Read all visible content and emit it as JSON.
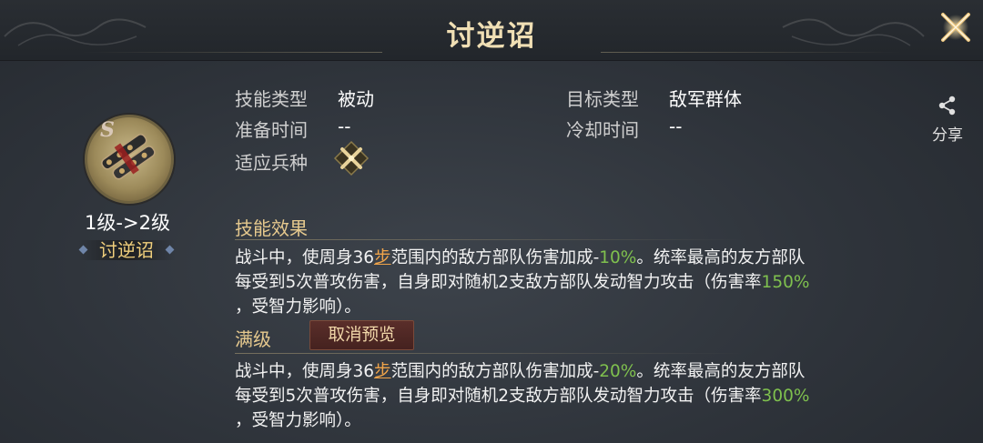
{
  "header": {
    "title": "讨逆诏"
  },
  "skill": {
    "grade": "S",
    "level_text": "1级->2级",
    "name": "讨逆诏"
  },
  "attributes": {
    "skill_type_label": "技能类型",
    "skill_type_value": "被动",
    "target_type_label": "目标类型",
    "target_type_value": "敌军群体",
    "prep_time_label": "准备时间",
    "prep_time_value": "--",
    "cooldown_label": "冷却时间",
    "cooldown_value": "--",
    "troop_label": "适应兵种",
    "troop_icon": "crossed-swords-icon"
  },
  "share": {
    "label": "分享"
  },
  "effect": {
    "title": "技能效果",
    "line1_a": "战斗中，使周身36",
    "line1_step": "步",
    "line1_b": "范围内的敌方部队伤害加成-",
    "line1_pct": "10%",
    "line1_c": "。统率最高的友方部队",
    "line2_a": "每受到5次普攻伤害，自身即对随机2支敌方部队发动智力攻击（伤害率",
    "line2_pct": "150%",
    "line3": "，受智力影响）。"
  },
  "max_level": {
    "title": "满级",
    "cancel_preview": "取消预览",
    "line1_a": "战斗中，使周身36",
    "line1_step": "步",
    "line1_b": "范围内的敌方部队伤害加成-",
    "line1_pct": "20%",
    "line1_c": "。统率最高的友方部队",
    "line2_a": "每受到5次普攻伤害，自身即对随机2支敌方部队发动智力攻击（伤害率",
    "line2_pct": "300%",
    "line3": "，受智力影响）。"
  },
  "colors": {
    "title_gold": "#f0dfb4",
    "section_gold": "#e6c98e",
    "highlight_orange": "#f0a44a",
    "value_green": "#7fc04e",
    "button_red": "#5a2e2a"
  }
}
